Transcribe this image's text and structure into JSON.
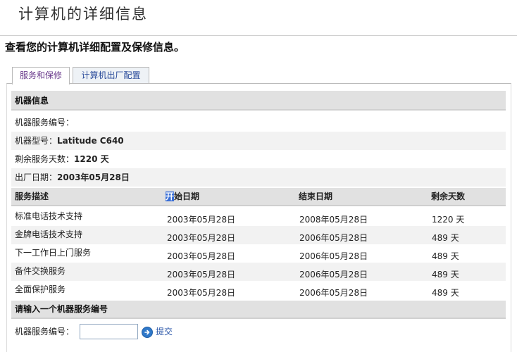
{
  "header": {
    "title": "计算机的详细信息",
    "subtitle": "查看您的计算机详细配置及保修信息。"
  },
  "tabs": [
    {
      "label": "服务和保修",
      "active": true
    },
    {
      "label": "计算机出厂配置",
      "active": false
    }
  ],
  "machine_info": {
    "section_title": "机器信息",
    "service_tag_label": "机器服务编号：",
    "service_tag_value": "",
    "model_label": "机器型号：",
    "model_value": "Latitude C640",
    "days_left_label": "剩余服务天数：",
    "days_left_value": "1220 天",
    "ship_date_label": "出厂日期：",
    "ship_date_value": "2003年05月28日"
  },
  "services": {
    "columns": {
      "description": "服务描述",
      "start_highlight": "开",
      "start_rest": "始日期",
      "end": "结束日期",
      "days_left": "剩余天数"
    },
    "rows": [
      {
        "description": "标准电话技术支持",
        "start": "2003年05月28日",
        "end": "2008年05月28日",
        "days_left": "1220 天"
      },
      {
        "description": "金牌电话技术支持",
        "start": "2003年05月28日",
        "end": "2006年05月28日",
        "days_left": "489 天"
      },
      {
        "description": "下一工作日上门服务",
        "start": "2003年05月28日",
        "end": "2006年05月28日",
        "days_left": "489 天"
      },
      {
        "description": "备件交换服务",
        "start": "2003年05月28日",
        "end": "2006年05月28日",
        "days_left": "489 天"
      },
      {
        "description": "全面保护服务",
        "start": "2003年05月28日",
        "end": "2006年05月28日",
        "days_left": "489 天"
      }
    ]
  },
  "lookup": {
    "section_title": "请输入一个机器服务编号",
    "field_label": "机器服务编号：",
    "field_value": "",
    "submit_label": "提交",
    "submit_icon": "arrow-right-circle-icon"
  },
  "colors": {
    "bar_background": "#e1e1e1",
    "link_blue": "#2a56a8",
    "active_tab_text": "#6a3a8c",
    "selection_highlight": "#3a6fd6"
  }
}
